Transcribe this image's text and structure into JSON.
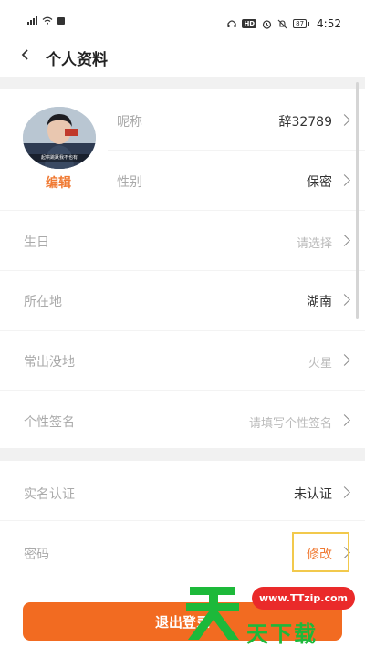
{
  "status_bar": {
    "time": "4:52",
    "battery": "87",
    "hd_label": "HD",
    "icons": [
      "signal-icon",
      "wifi-icon",
      "app-notify-icon",
      "headset-icon",
      "hd-icon",
      "alarm-icon",
      "mute-icon",
      "battery-icon"
    ]
  },
  "header": {
    "title": "个人资料",
    "back_icon": "chevron-left-icon"
  },
  "profile": {
    "avatar_caption": "起哄跳跃我不也有",
    "edit_label": "编辑",
    "nickname_label": "昵称",
    "nickname_value": "辞32789",
    "gender_label": "性别",
    "gender_value": "保密"
  },
  "fields": {
    "birthday_label": "生日",
    "birthday_value": "请选择",
    "location_label": "所在地",
    "location_value": "湖南",
    "haunt_label": "常出没地",
    "haunt_value": "火星",
    "signature_label": "个性签名",
    "signature_value": "请填写个性签名"
  },
  "account": {
    "realname_label": "实名认证",
    "realname_value": "未认证",
    "password_label": "密码",
    "password_value": "修改"
  },
  "logout_label": "退出登录",
  "watermark": {
    "url": "www.TTzip.com",
    "brand": "天下载",
    "logo_char": "天"
  },
  "colors": {
    "accent": "#f07a33",
    "logout": "#f26b21",
    "highlight": "#f2c94c",
    "watermark_green": "#1db93a",
    "watermark_red": "#ea2a2a"
  }
}
